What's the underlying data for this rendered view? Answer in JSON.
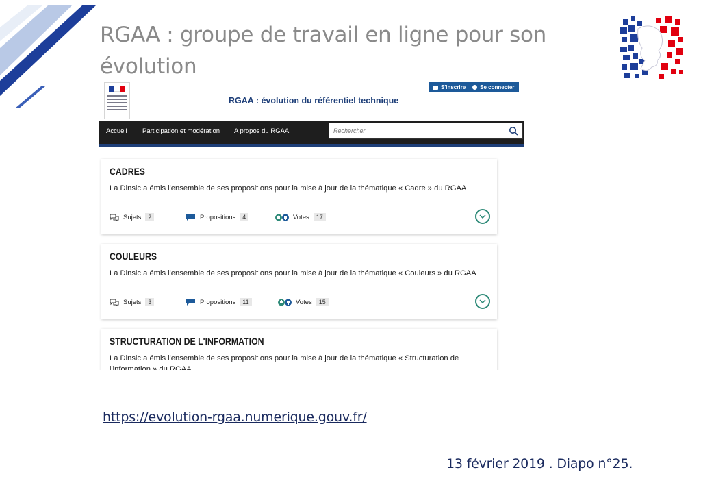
{
  "slide": {
    "title": "RGAA : groupe de travail en ligne pour son évolution",
    "url": "https://evolution-rgaa.numerique.gouv.fr/",
    "footer": "13 février 2019 . Diapo n°25.",
    "logo_icon": "marianne-logo-icon"
  },
  "site": {
    "title": "RGAA : évolution du référentiel technique",
    "top_links": [
      {
        "label": "S'inscrire",
        "icon": "register-icon"
      },
      {
        "label": "Se connecter",
        "icon": "login-icon"
      }
    ],
    "nav": [
      "Accueil",
      "Participation et modération",
      "A propos du RGAA"
    ],
    "search_placeholder": "Rechercher",
    "colors": {
      "primary": "#1d3e78",
      "navbar": "#1e1e1e",
      "accent": "#2e8a78"
    }
  },
  "cards": [
    {
      "title": "CADRES",
      "description": "La Dinsic a émis l'ensemble de ses propositions pour la mise à jour de la thématique « Cadre » du RGAA",
      "stats": [
        {
          "label": "Sujets",
          "count": "2"
        },
        {
          "label": "Propositions",
          "count": "4"
        },
        {
          "label": "Votes",
          "count": "17"
        }
      ]
    },
    {
      "title": "COULEURS",
      "description": "La Dinsic a émis l'ensemble de ses propositions pour la mise à jour de la thématique « Couleurs » du RGAA",
      "stats": [
        {
          "label": "Sujets",
          "count": "3"
        },
        {
          "label": "Propositions",
          "count": "11"
        },
        {
          "label": "Votes",
          "count": "15"
        }
      ]
    },
    {
      "title": "STRUCTURATION DE L'INFORMATION",
      "description": "La Dinsic a émis l'ensemble de ses propositions pour la mise à jour de la thématique « Structuration de l'information » du RGAA"
    }
  ]
}
